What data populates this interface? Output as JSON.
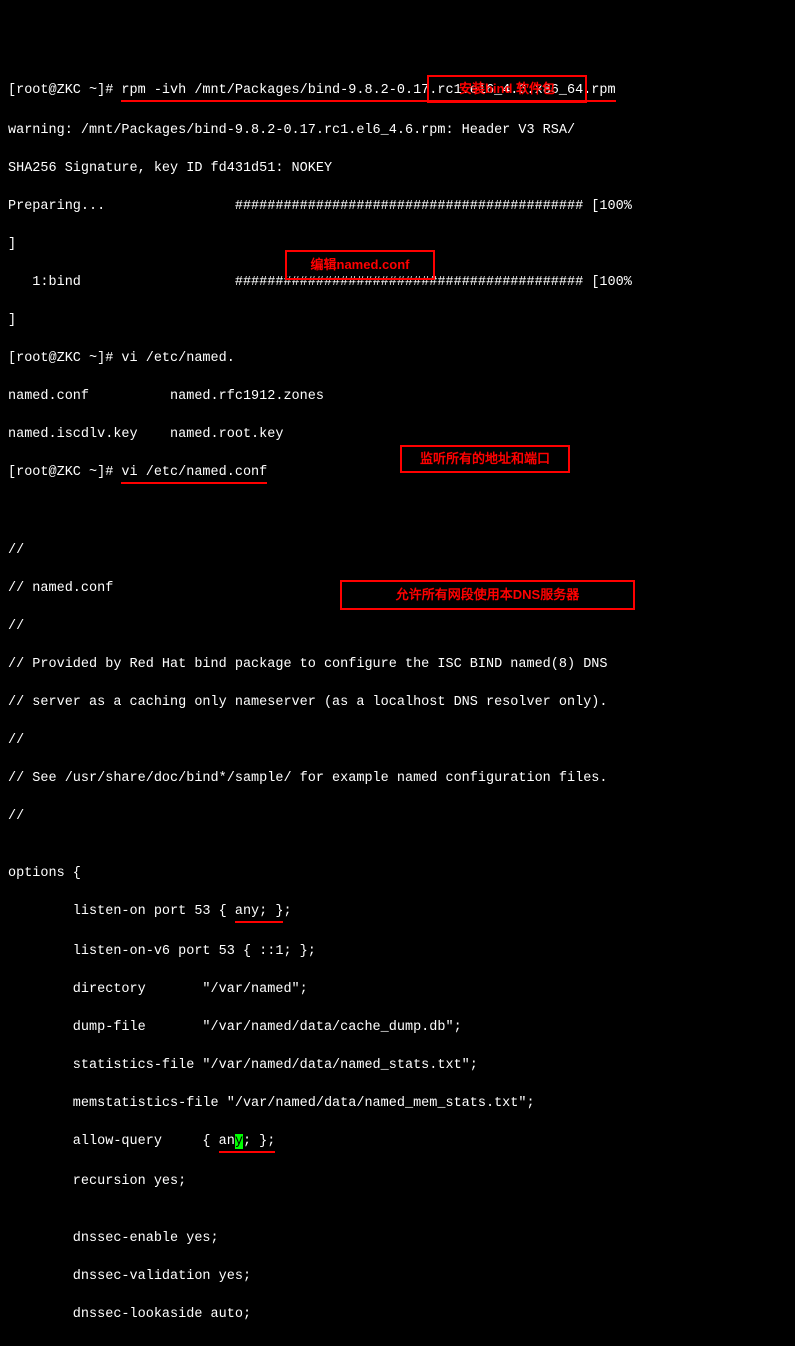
{
  "prompt1_pre": "[root@ZKC ~]# ",
  "cmd1": "rpm -ivh /mnt/Packages/bind-9.8.2-0.17.rc1.el6_4.6.x86_64.rpm",
  "warn1": "warning: /mnt/Packages/bind-9.8.2-0.17.rc1.el6_4.6.rpm: Header V3 RSA/",
  "warn2": "SHA256 Signature, key ID fd431d51: NOKEY",
  "prep_label": "Preparing...",
  "hashes": "########################################### [100%",
  "hash_close": "]",
  "bind_line": "   1:bind",
  "prompt2": "[root@ZKC ~]# vi /etc/named.",
  "tab_line1": "named.conf          named.rfc1912.zones",
  "tab_line2": "named.iscdlv.key    named.root.key",
  "prompt3_pre": "[root@ZKC ~]# ",
  "prompt3_cmd": "vi /etc/named.conf",
  "c01": "//",
  "c02": "// named.conf",
  "c03": "//",
  "c04": "// Provided by Red Hat bind package to configure the ISC BIND named(8) DNS",
  "c05": "// server as a caching only nameserver (as a localhost DNS resolver only).",
  "c06": "//",
  "c07": "// See /usr/share/doc/bind*/sample/ for example named configuration files.",
  "c08": "//",
  "c09": "",
  "c10": "options {",
  "c11_pre": "        listen-on port 53 { ",
  "c11_mid": "any; }",
  "c11_post": ";",
  "c12": "        listen-on-v6 port 53 { ::1; };",
  "c13": "        directory       \"/var/named\";",
  "c14": "        dump-file       \"/var/named/data/cache_dump.db\";",
  "c15": "        statistics-file \"/var/named/data/named_stats.txt\";",
  "c16": "        memstatistics-file \"/var/named/data/named_mem_stats.txt\";",
  "c17_pre": "        allow-query     { ",
  "c17_a": "an",
  "c17_cur": "y",
  "c17_b": "; };",
  "c18": "        recursion yes;",
  "c19": "",
  "c20": "        dnssec-enable yes;",
  "c21": "        dnssec-validation yes;",
  "c22": "        dnssec-lookaside auto;",
  "annot1": "安装bind 软件包",
  "annot2": "编辑named.conf",
  "annot3": "监听所有的地址和端口",
  "annot4": "允许所有网段使用本DNS服务器"
}
